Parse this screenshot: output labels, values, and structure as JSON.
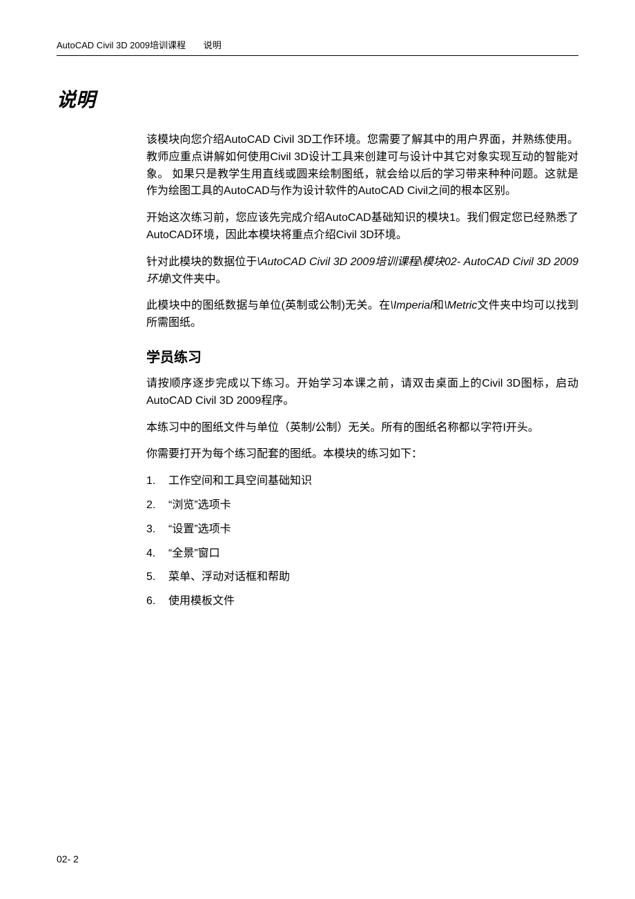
{
  "header": {
    "course": "AutoCAD Civil 3D 2009培训课程",
    "section": "说明"
  },
  "title": "说明",
  "paragraphs": {
    "p1": "该模块向您介绍AutoCAD Civil 3D工作环境。您需要了解其中的用户界面，并熟练使用。教师应重点讲解如何使用Civil 3D设计工具来创建可与设计中其它对象实现互动的智能对象。  如果只是教学生用直线或圆来绘制图纸，就会给以后的学习带来种种问题。这就是作为绘图工具的AutoCAD与作为设计软件的AutoCAD Civil之间的根本区别。",
    "p2": "开始这次练习前，您应该先完成介绍AutoCAD基础知识的模块1。我们假定您已经熟悉了AutoCAD环境，因此本模块将重点介绍Civil 3D环境。",
    "p3_a": "针对此模块的数据位于",
    "p3_b": "\\AutoCAD Civil 3D 2009培训课程\\模块02- AutoCAD Civil 3D 2009环境\\",
    "p3_c": "文件夹中。",
    "p4_a": "此模块中的图纸数据与单位(英制或公制)无关。在",
    "p4_b": "\\Imperial",
    "p4_c": "和",
    "p4_d": "\\Metric",
    "p4_e": "文件夹中均可以找到所需图纸。"
  },
  "subtitle": "学员练习",
  "exercises": {
    "p5": "请按顺序逐步完成以下练习。开始学习本课之前，请双击桌面上的Civil 3D图标，启动AutoCAD Civil 3D 2009程序。",
    "p6": "本练习中的图纸文件与单位（英制/公制）无关。所有的图纸名称都以字符I开头。",
    "p7": "你需要打开为每个练习配套的图纸。本模块的练习如下：",
    "items": [
      {
        "num": "1.",
        "text": "工作空间和工具空间基础知识"
      },
      {
        "num": "2.",
        "text": "“浏览”选项卡"
      },
      {
        "num": "3.",
        "text": "“设置”选项卡"
      },
      {
        "num": "4.",
        "text": "“全景”窗口"
      },
      {
        "num": "5.",
        "text": "菜单、浮动对话框和帮助"
      },
      {
        "num": "6.",
        "text": "使用模板文件"
      }
    ]
  },
  "footer": "02- 2"
}
